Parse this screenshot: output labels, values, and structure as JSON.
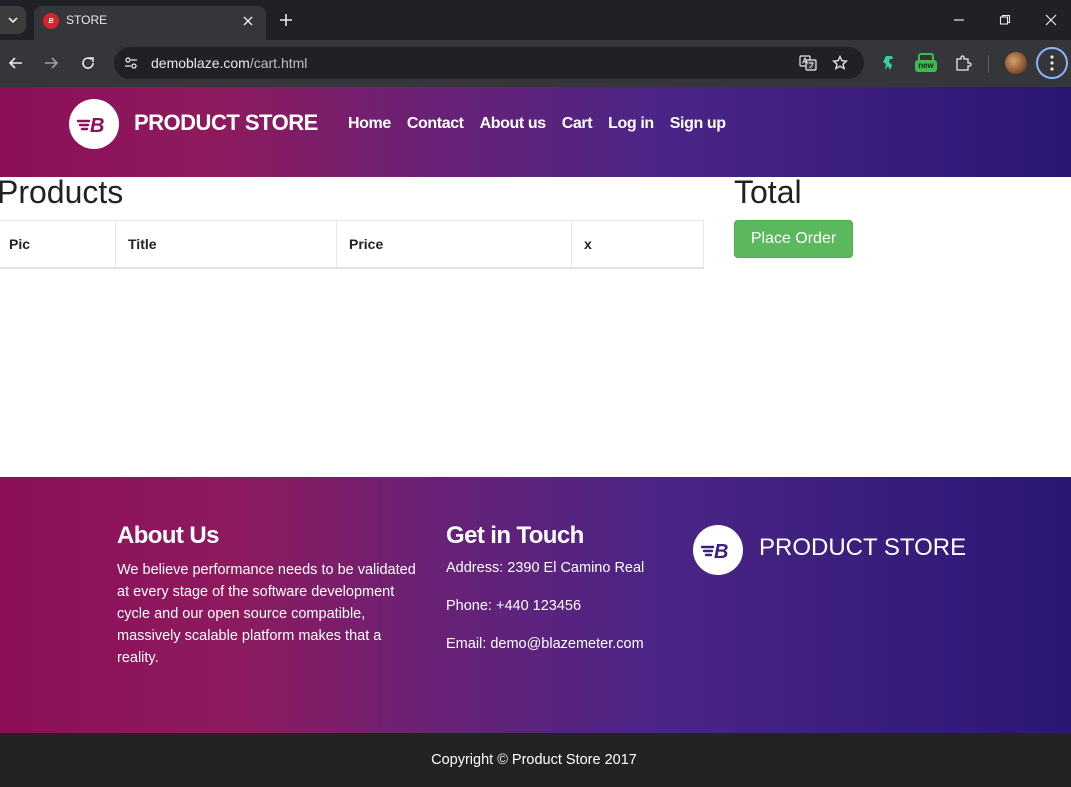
{
  "browser": {
    "tab_title": "STORE",
    "favicon_text": "B",
    "url_domain": "demoblaze.com",
    "url_path": "/cart.html",
    "extension_badge": "new"
  },
  "navbar": {
    "brand": "PRODUCT STORE",
    "links": [
      "Home",
      "Contact",
      "About us",
      "Cart",
      "Log in",
      "Sign up"
    ]
  },
  "cart": {
    "products_title": "Products",
    "columns": [
      "Pic",
      "Title",
      "Price",
      "x"
    ],
    "rows": [],
    "total_title": "Total",
    "place_order_label": "Place Order"
  },
  "footer": {
    "about_heading": "About Us",
    "about_text": "We believe performance needs to be validated at every stage of the software development cycle and our open source compatible, massively scalable platform makes that a reality.",
    "contact_heading": "Get in Touch",
    "address": "Address: 2390 El Camino Real",
    "phone": "Phone: +440 123456",
    "email": "Email: demo@blazemeter.com",
    "brand": "PRODUCT STORE",
    "copyright": "Copyright © Product Store 2017"
  },
  "colors": {
    "navbar_gradient_start": "#8c0f57",
    "navbar_gradient_end": "#2b1674",
    "place_order_button": "#5cb85c",
    "copyright_bar": "#232323"
  }
}
